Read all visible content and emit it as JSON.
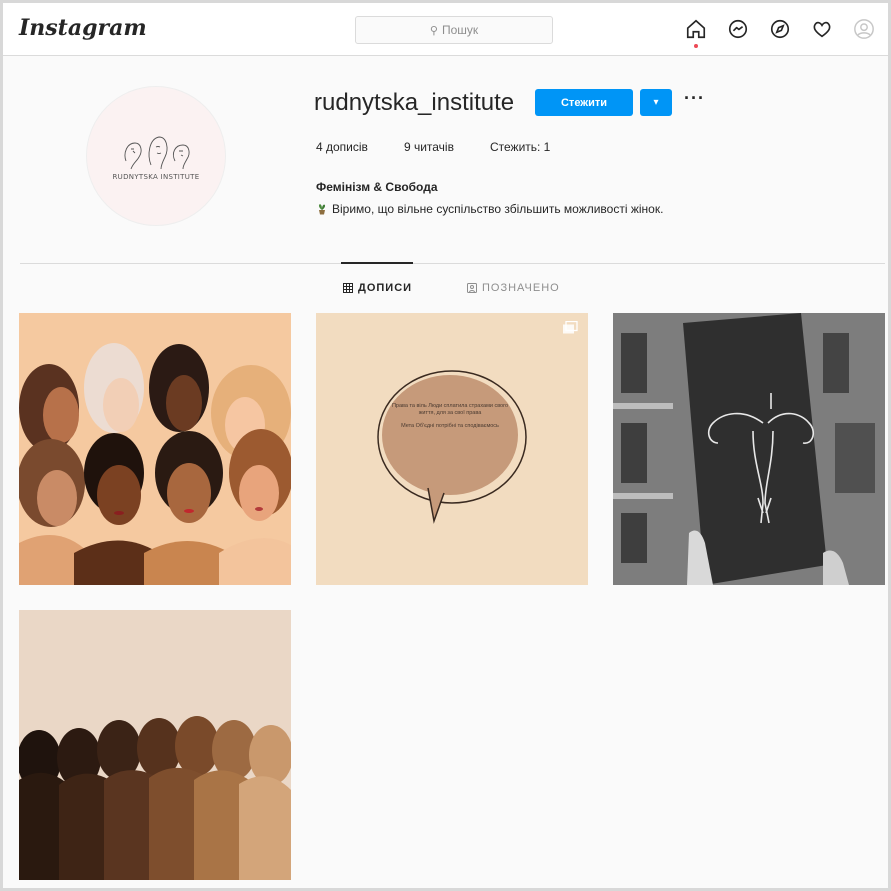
{
  "app": {
    "logo": "Instagram"
  },
  "search": {
    "placeholder": "Пошук"
  },
  "nav": {
    "icons": [
      "home-icon",
      "messenger-icon",
      "explore-icon",
      "heart-icon",
      "profile-icon"
    ]
  },
  "profile": {
    "avatar_text": "RUDNYTSKA INSTITUTE",
    "username": "rudnytska_institute",
    "follow_label": "Стежити",
    "stats": {
      "posts": "4 дописів",
      "followers": "9 читачів",
      "following": "Стежить: 1"
    },
    "bio_name": "Фемінізм & Свобода",
    "bio_text": "Віримо, що вільне суспільство збільшить можливості жінок."
  },
  "tabs": [
    {
      "label": "ДОПИСИ",
      "icon": "grid-icon",
      "active": true
    },
    {
      "label": "ПОЗНАЧЕНО",
      "icon": "tag-icon",
      "active": false
    }
  ],
  "posts": {
    "count": 4,
    "bubble_paragraph_1": "Права та віль Люди сплатила страхами свого життя, для за свої права",
    "bubble_paragraph_2": "Мета Об'єдні потрібні та сподіваємось"
  },
  "colors": {
    "accent": "#0095f6",
    "border": "#dbdbdb",
    "background": "#fafafa"
  }
}
